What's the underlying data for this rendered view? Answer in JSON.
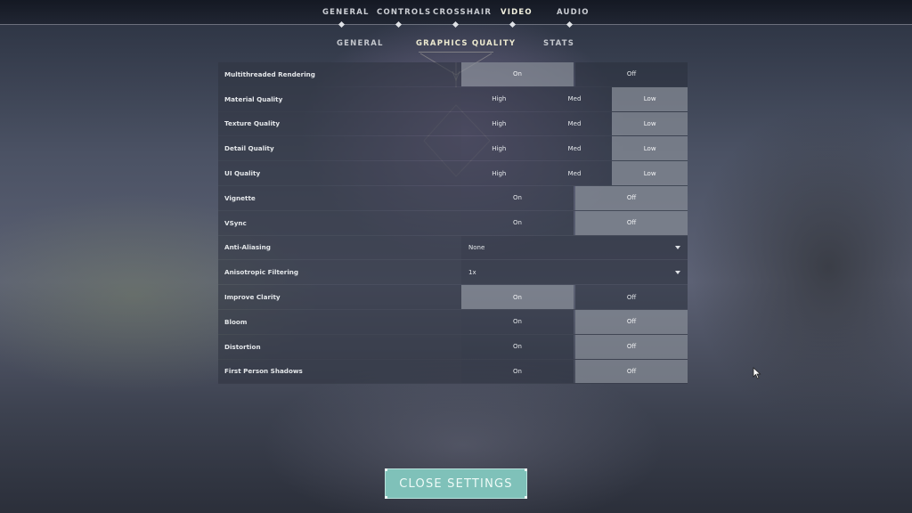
{
  "top_nav": {
    "tabs": [
      "GENERAL",
      "CONTROLS",
      "CROSSHAIR",
      "VIDEO",
      "AUDIO"
    ],
    "active": "VIDEO"
  },
  "sub_nav": {
    "tabs": [
      "GENERAL",
      "GRAPHICS QUALITY",
      "STATS"
    ],
    "active": "GRAPHICS QUALITY"
  },
  "settings": [
    {
      "label": "Multithreaded Rendering",
      "type": "toggle",
      "options": [
        "On",
        "Off"
      ],
      "selected": "On"
    },
    {
      "label": "Material Quality",
      "type": "tri",
      "options": [
        "High",
        "Med",
        "Low"
      ],
      "selected": "Low"
    },
    {
      "label": "Texture Quality",
      "type": "tri",
      "options": [
        "High",
        "Med",
        "Low"
      ],
      "selected": "Low"
    },
    {
      "label": "Detail Quality",
      "type": "tri",
      "options": [
        "High",
        "Med",
        "Low"
      ],
      "selected": "Low"
    },
    {
      "label": "UI Quality",
      "type": "tri",
      "options": [
        "High",
        "Med",
        "Low"
      ],
      "selected": "Low"
    },
    {
      "label": "Vignette",
      "type": "toggle",
      "options": [
        "On",
        "Off"
      ],
      "selected": "Off"
    },
    {
      "label": "VSync",
      "type": "toggle",
      "options": [
        "On",
        "Off"
      ],
      "selected": "Off"
    },
    {
      "label": "Anti-Aliasing",
      "type": "dropdown",
      "value": "None"
    },
    {
      "label": "Anisotropic Filtering",
      "type": "dropdown",
      "value": "1x"
    },
    {
      "label": "Improve Clarity",
      "type": "toggle",
      "options": [
        "On",
        "Off"
      ],
      "selected": "On"
    },
    {
      "label": "Bloom",
      "type": "toggle",
      "options": [
        "On",
        "Off"
      ],
      "selected": "Off"
    },
    {
      "label": "Distortion",
      "type": "toggle",
      "options": [
        "On",
        "Off"
      ],
      "selected": "Off"
    },
    {
      "label": "First Person Shadows",
      "type": "toggle",
      "options": [
        "On",
        "Off"
      ],
      "selected": "Off"
    }
  ],
  "close_button": {
    "label": "CLOSE SETTINGS"
  },
  "colors": {
    "accent": "#7fc1b9",
    "selected": "#878c96",
    "active_tab": "#f1f0df"
  }
}
